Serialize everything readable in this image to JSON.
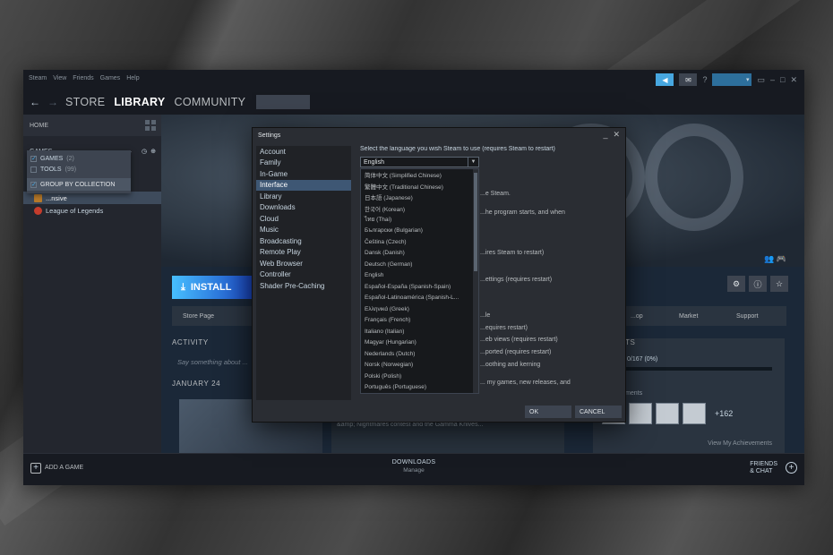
{
  "menu": [
    "Steam",
    "View",
    "Friends",
    "Games",
    "Help"
  ],
  "titlebar": {
    "help_label": "?"
  },
  "nav": {
    "back": "←",
    "forward": "→",
    "store": "STORE",
    "library": "LIBRARY",
    "community": "COMMUNITY"
  },
  "left": {
    "home": "HOME",
    "games_header": "GAMES",
    "filter": [
      {
        "label": "GAMES",
        "count": "(2)",
        "checked": true
      },
      {
        "label": "TOOLS",
        "count": "(99)",
        "checked": false
      }
    ],
    "group_by": "GROUP BY COLLECTION",
    "games": [
      "Counter-Strike: Global Offensive",
      "League of Legends"
    ],
    "games_visible": [
      "...nsive",
      "League of Legends"
    ]
  },
  "bottom": {
    "add_game": "ADD A GAME",
    "downloads": "DOWNLOADS",
    "downloads_sub": "Manage",
    "friends": "FRIENDS",
    "chat": "& CHAT"
  },
  "main": {
    "install": "INSTALL",
    "tabs": {
      "store": "Store Page",
      "shop": "...op",
      "market": "Market",
      "support": "Support"
    },
    "activity": "ACTIVITY",
    "say_placeholder": "Say something about ...",
    "date": "JANUARY 24",
    "news_text": "Today we shipping the Dreams &amp; Nightmares Case, featuring 17 weapon finishes selected from the CS:GO Steam Workshop as part of the Dreams &amp; Nightmares contest and the Gamma Knives...",
    "ach_title": "...MENTS",
    "ach_unlocked": "...locked 0/167 (0%)",
    "ach_label": "...chievements",
    "ach_more": "+162",
    "view_ach": "View My Achievements"
  },
  "settings": {
    "title": "Settings",
    "nav": [
      "Account",
      "Family",
      "In-Game",
      "Interface",
      "Library",
      "Downloads",
      "Cloud",
      "Music",
      "Broadcasting",
      "Remote Play",
      "Web Browser",
      "Controller",
      "Shader Pre-Caching"
    ],
    "active": "Interface",
    "language_prompt": "Select the language you wish Steam to use (requires Steam to restart)",
    "selected_language": "English",
    "languages": [
      "简体中文 (Simplified Chinese)",
      "繁體中文 (Traditional Chinese)",
      "日本語 (Japanese)",
      "한국어 (Korean)",
      "ไทย (Thai)",
      "Български (Bulgarian)",
      "Čeština (Czech)",
      "Dansk (Danish)",
      "Deutsch (German)",
      "English",
      "Español-España (Spanish-Spain)",
      "Español-Latinoamérica (Spanish-L...",
      "Ελληνικά (Greek)",
      "Français (French)",
      "Italiano (Italian)",
      "Magyar (Hungarian)",
      "Nederlands (Dutch)",
      "Norsk (Norwegian)",
      "Polski (Polish)",
      "Português (Portuguese)"
    ],
    "behind_lines": [
      "...e Steam.",
      "...he program starts, and when",
      "...ires Steam to restart)",
      "...ettings (requires restart)",
      "...le",
      "...equires restart)",
      "...eb views (requires restart)",
      "...ported (requires restart)",
      "...oothing and kerning",
      "... my games, new releases, and"
    ],
    "ok": "OK",
    "cancel": "CANCEL"
  },
  "colors": {
    "accent": "#47a7e0",
    "window_bg": "#1b2838",
    "dialog_bg": "#2a2d33",
    "selected_nav": "#3e5774"
  }
}
